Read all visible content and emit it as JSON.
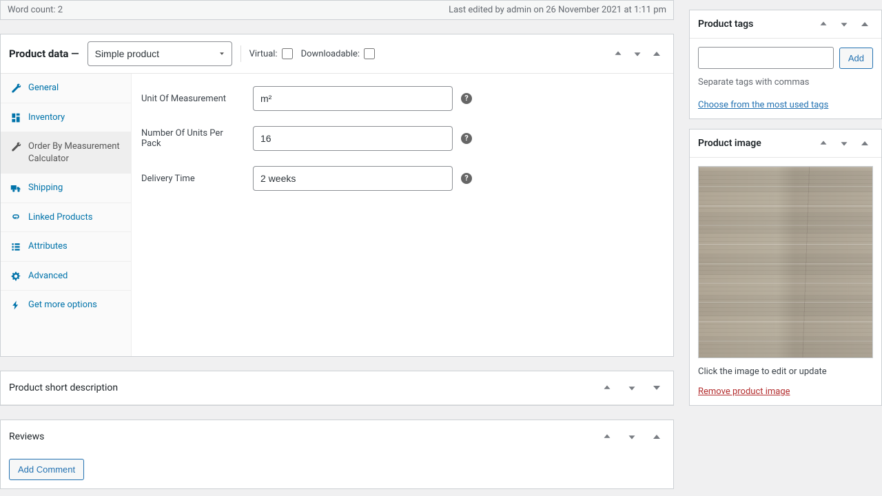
{
  "editorFooter": {
    "wordCount": "Word count: 2",
    "lastEdited": "Last edited by admin on 26 November 2021 at 1:11 pm"
  },
  "productData": {
    "heading": "Product data —",
    "typeSelected": "Simple product",
    "virtualLabel": "Virtual:",
    "downloadableLabel": "Downloadable:",
    "tabs": {
      "general": "General",
      "inventory": "Inventory",
      "order_by_measurement": "Order By Measurement Calculator",
      "shipping": "Shipping",
      "linked_products": "Linked Products",
      "attributes": "Attributes",
      "advanced": "Advanced",
      "get_more": "Get more options"
    },
    "fields": {
      "unit_label": "Unit Of Measurement",
      "unit_value": "m²",
      "units_per_pack_label": "Number Of Units Per Pack",
      "units_per_pack_value": "16",
      "delivery_label": "Delivery Time",
      "delivery_value": "2 weeks"
    }
  },
  "shortDesc": {
    "title": "Product short description"
  },
  "reviews": {
    "title": "Reviews",
    "addComment": "Add Comment"
  },
  "productTags": {
    "title": "Product tags",
    "addBtn": "Add",
    "input": "",
    "hint": "Separate tags with commas",
    "chooseLink": "Choose from the most used tags"
  },
  "productImage": {
    "title": "Product image",
    "clickHint": "Click the image to edit or update",
    "removeLink": "Remove product image"
  }
}
